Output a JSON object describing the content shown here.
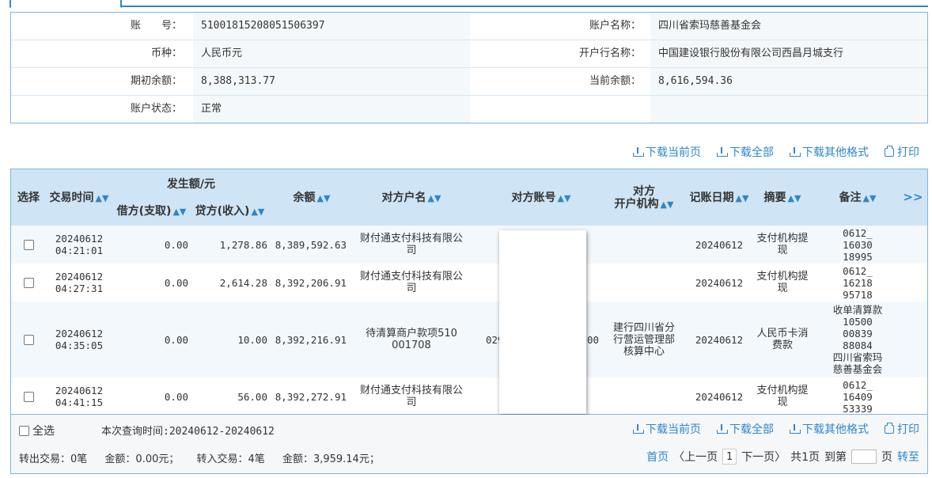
{
  "account": {
    "number_label": "账　　号：",
    "number": "51001815208051506397",
    "name_label": "账户名称：",
    "name": "四川省索玛慈善基金会",
    "currency_label": "币种：",
    "currency": "人民币元",
    "bank_label": "开户行名称：",
    "bank": "中国建设银行股份有限公司西昌月城支行",
    "opening_label": "期初余额：",
    "opening": "8,388,313.77",
    "current_label": "当前余额：",
    "current": "8,616,594.36",
    "status_label": "账户状态：",
    "status": "正常"
  },
  "actions": {
    "download_page": "下载当前页",
    "download_all": "下载全部",
    "download_other": "下载其他格式",
    "print": "打印"
  },
  "table": {
    "headers": {
      "select": "选择",
      "time": "交易时间",
      "amount_group": "发生额/元",
      "debit": "借方(支取)",
      "credit": "贷方(收入)",
      "balance": "余额",
      "counter_name": "对方户名",
      "counter_account": "对方账号",
      "counter_bank_1": "对方",
      "counter_bank_2": "开户机构",
      "date": "记账日期",
      "summary": "摘要",
      "remark": "备注",
      "more": ">>"
    },
    "rows": [
      {
        "date1": "20240612",
        "time1": "04:21:01",
        "debit": "0.00",
        "credit": "1,278.86",
        "balance": "8,389,592.63",
        "name": "财付通支付科技有限公司",
        "account": "",
        "bank": "",
        "post_date": "20240612",
        "summary": "支付机构提现",
        "remark": [
          "0612_",
          "16030",
          "18995"
        ]
      },
      {
        "date1": "20240612",
        "time1": "04:27:31",
        "debit": "0.00",
        "credit": "2,614.28",
        "balance": "8,392,206.91",
        "name": "财付通支付科技有限公司",
        "account": "",
        "bank": "",
        "post_date": "20240612",
        "summary": "支付机构提现",
        "remark": [
          "0612_",
          "16218",
          "95718"
        ]
      },
      {
        "date1": "20240612",
        "time1": "04:35:05",
        "debit": "0.00",
        "credit": "10.00",
        "balance": "8,392,216.91",
        "name": "待清算商户款项510001708",
        "account_left": "029",
        "account_right": "00",
        "bank": "建行四川省分行营运管理部核算中心",
        "post_date": "20240612",
        "summary": "人民币卡消费款",
        "remark": [
          "收单清算款",
          "10500",
          "00839",
          "88084",
          "四川省索玛",
          "慈善基金会"
        ]
      },
      {
        "date1": "20240612",
        "time1": "04:41:15",
        "debit": "0.00",
        "credit": "56.00",
        "balance": "8,392,272.91",
        "name": "财付通支付科技有限公司",
        "account": "",
        "bank": "",
        "post_date": "20240612",
        "summary": "支付机构提现",
        "remark": [
          "0612_",
          "16409",
          "53339"
        ]
      }
    ]
  },
  "footer": {
    "select_all": "全选",
    "query_time": "本次查询时间:20240612-20240612",
    "out_count": "转出交易：0笔",
    "out_amount": "金额：0.00元；",
    "in_count": "转入交易：4笔",
    "in_amount": "金额：3,959.14元；",
    "first": "首页",
    "prev": "〈上一页",
    "current_page": "1",
    "next": "下一页〉",
    "total": "共1页",
    "goto": "到第",
    "page_unit": "页",
    "jump": "转至"
  },
  "colors": {
    "accent": "#2f86c8",
    "header_bg": "#cfe4f4",
    "border": "#7fb6dd"
  }
}
